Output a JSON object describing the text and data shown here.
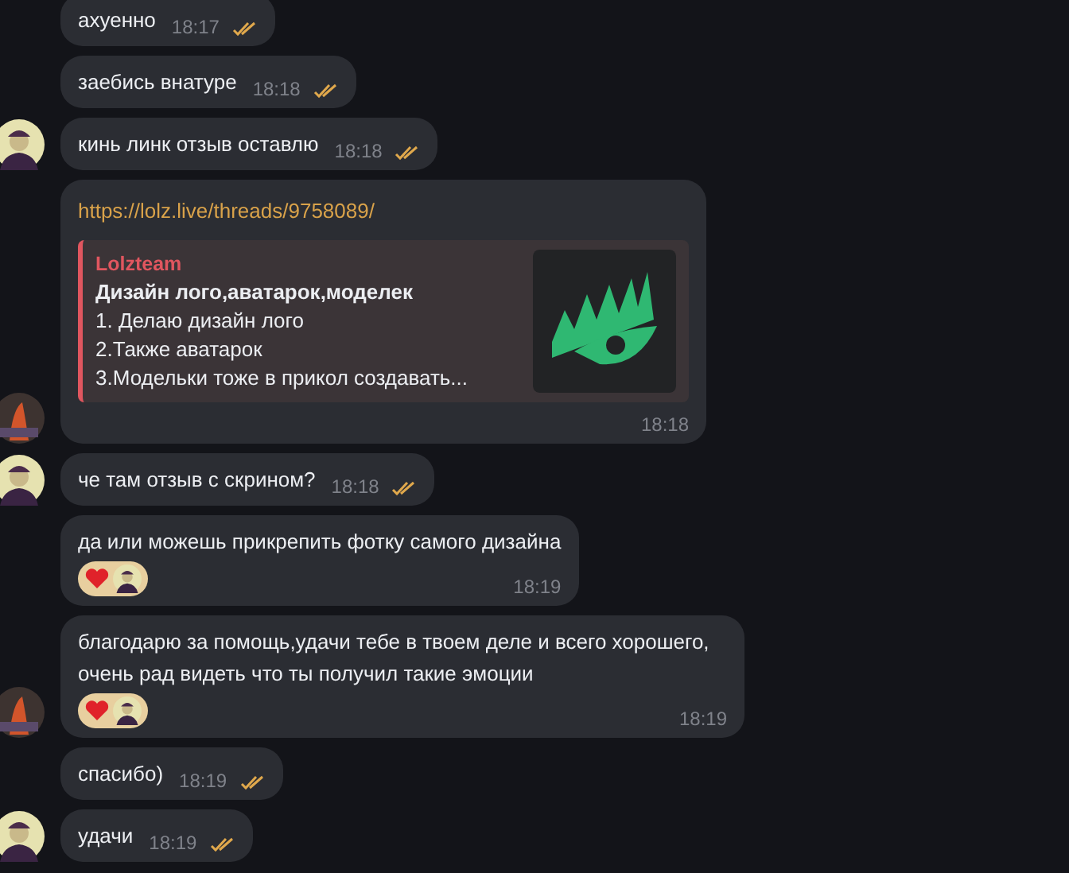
{
  "messages": [
    {
      "kind": "text",
      "text": "ахуенно",
      "time": "18:17",
      "checks": true
    },
    {
      "kind": "text",
      "text": "заебись внатуре",
      "time": "18:18",
      "checks": true
    },
    {
      "kind": "text",
      "text": "кинь линк отзыв оставлю",
      "time": "18:18",
      "checks": true,
      "avatar": {
        "kind": "person"
      }
    },
    {
      "kind": "link",
      "url": "https://lolz.live/threads/9758089/",
      "preview": {
        "site": "Lolzteam",
        "title": "Дизайн лого,аватарок,моделек",
        "lines": [
          "1. Делаю дизайн лого",
          "2.Также аватарок",
          "3.Модельки тоже в прикол создавать..."
        ]
      },
      "time": "18:18",
      "checks": false,
      "avatar": {
        "kind": "orange"
      }
    },
    {
      "kind": "text",
      "text": "че там отзыв с скрином?",
      "time": "18:18",
      "checks": true,
      "avatar": {
        "kind": "person"
      }
    },
    {
      "kind": "text",
      "text": "да или можешь прикрепить фотку самого дизайна",
      "time": "18:19",
      "checks": false,
      "reaction": {
        "kind": "heart"
      }
    },
    {
      "kind": "text",
      "text": "благодарю за помощь,удачи тебе в твоем деле и всего хорошего, очень рад видеть что ты получил такие эмоции",
      "time": "18:19",
      "checks": false,
      "reaction": {
        "kind": "heart"
      },
      "avatar": {
        "kind": "orange"
      }
    },
    {
      "kind": "text",
      "text": "спасибо)",
      "time": "18:19",
      "checks": true
    },
    {
      "kind": "text",
      "text": "удачи",
      "time": "18:19",
      "checks": true,
      "avatar": {
        "kind": "person"
      }
    }
  ]
}
